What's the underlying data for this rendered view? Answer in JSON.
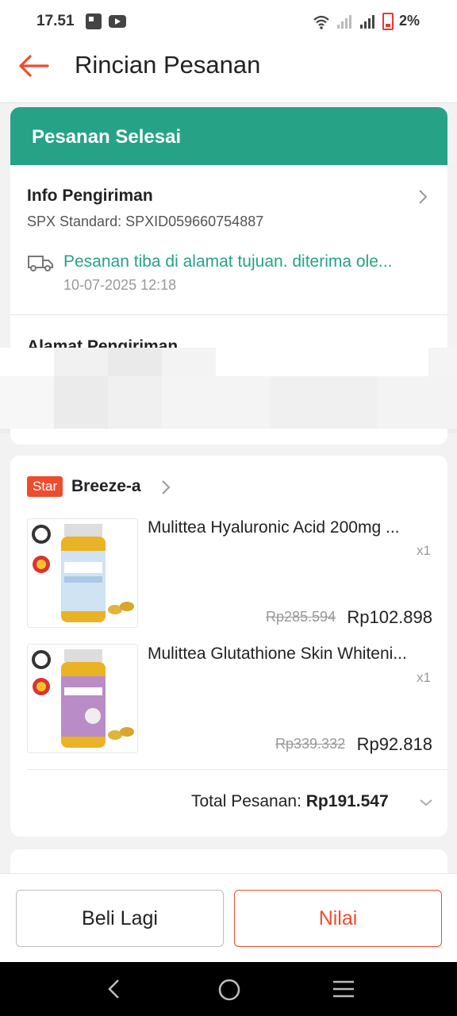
{
  "status_bar": {
    "time": "17.51",
    "battery_percent": "2%"
  },
  "header": {
    "title": "Rincian Pesanan"
  },
  "order_status": {
    "title": "Pesanan Selesai",
    "accent_color": "#26a386"
  },
  "shipping": {
    "title": "Info Pengiriman",
    "tracking": "SPX Standard: SPXID059660754887",
    "status": "Pesanan tiba di alamat tujuan. diterima ole...",
    "datetime": "10-07-2025 12:18"
  },
  "address": {
    "title": "Alamat Pengiriman"
  },
  "shop": {
    "badge": "Star",
    "name": "Breeze-a"
  },
  "products": [
    {
      "name": "Mulittea Hyaluronic Acid 200mg ...",
      "qty": "x1",
      "price_original": "Rp285.594",
      "price_final": "Rp102.898",
      "image_icon": "hyaluronic-acid-bottle"
    },
    {
      "name": "Mulittea Glutathione Skin Whiteni...",
      "qty": "x1",
      "price_original": "Rp339.332",
      "price_final": "Rp92.818",
      "image_icon": "glutathione-bottle"
    }
  ],
  "total": {
    "label": "Total Pesanan: ",
    "value": "Rp191.547"
  },
  "actions": {
    "rebuy_label": "Beli Lagi",
    "rate_label": "Nilai"
  },
  "colors": {
    "brand": "#ee4d2d",
    "success": "#26a386"
  }
}
